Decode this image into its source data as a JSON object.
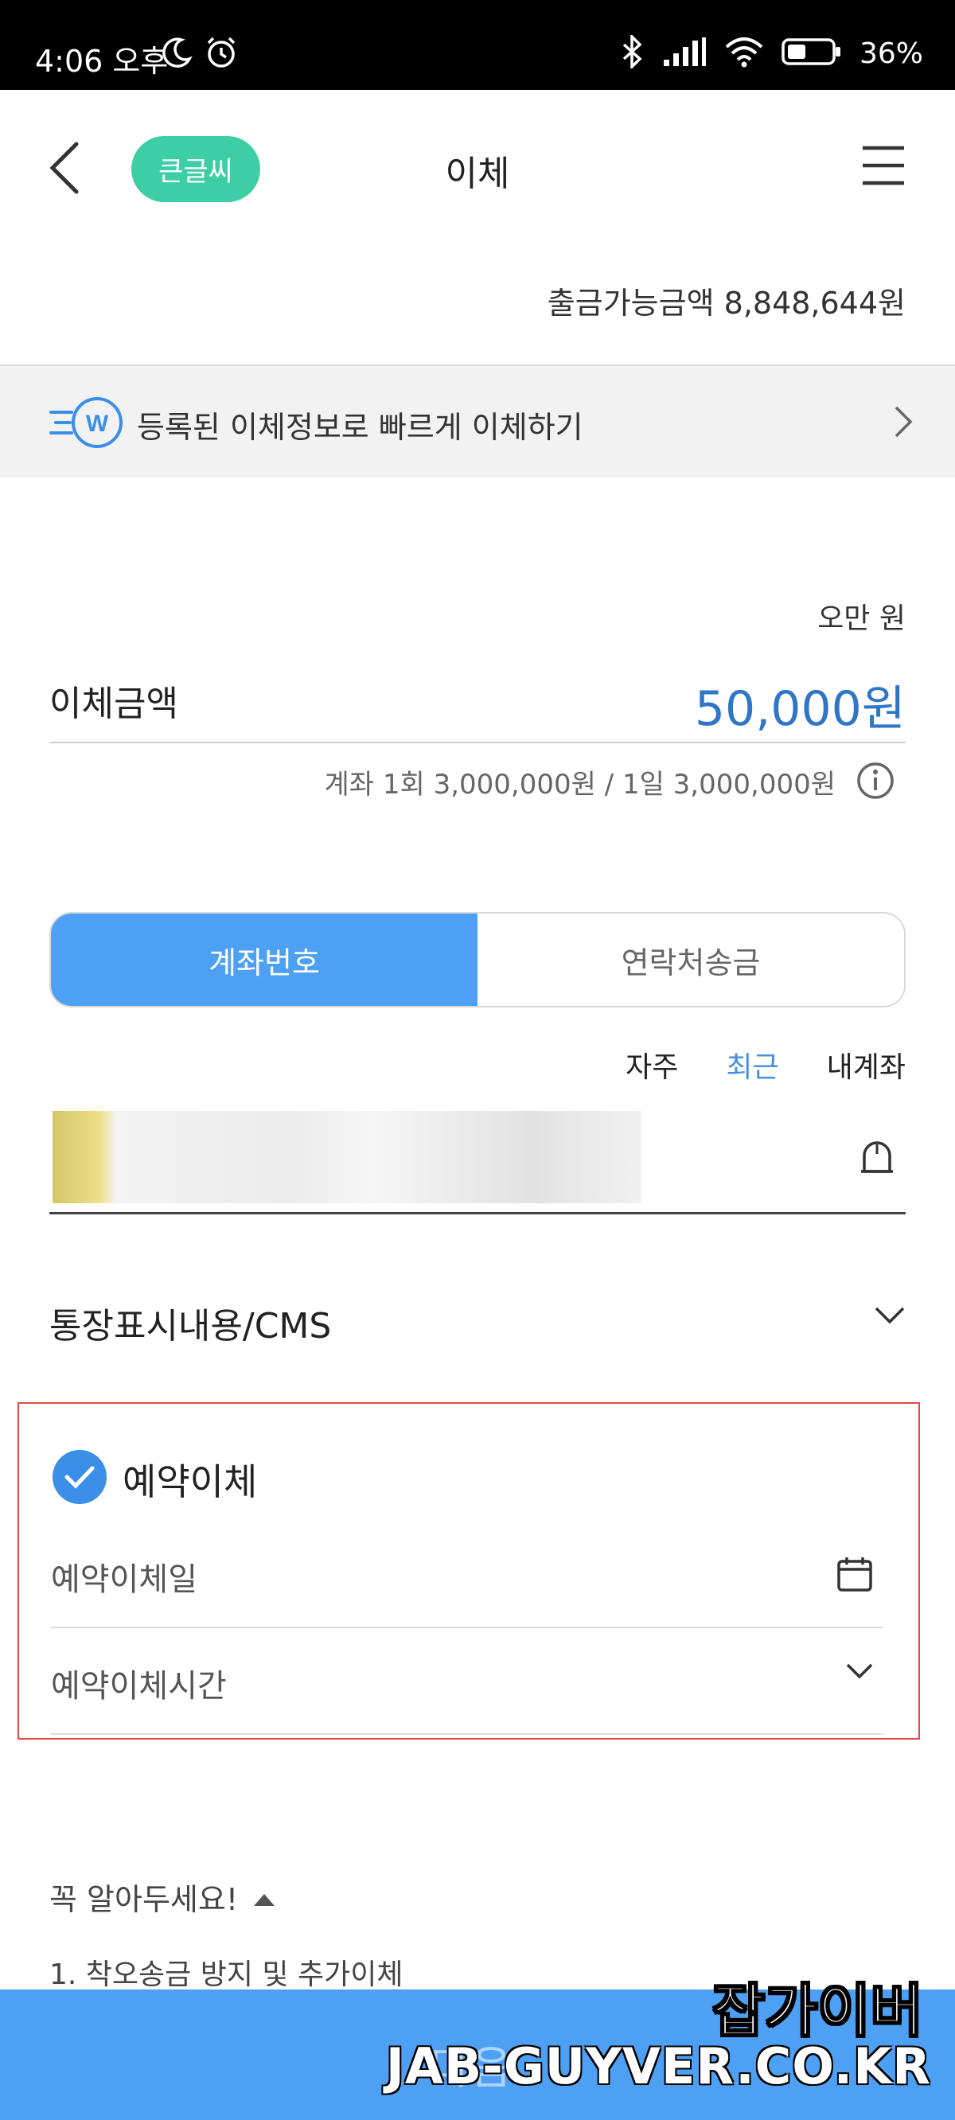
{
  "status_bar": {
    "time": "4:06 오후",
    "battery": "36%"
  },
  "header": {
    "font_size_chip": "큰글씨",
    "title": "이체"
  },
  "balance_text": "출금가능금액 8,848,644원",
  "quick_transfer": {
    "label": "등록된 이체정보로 빠르게 이체하기"
  },
  "amount": {
    "hangul": "오만 원",
    "label": "이체금액",
    "value": "50,000원",
    "limit": "계좌 1회 3,000,000원 / 1일 3,000,000원"
  },
  "tabs": [
    {
      "label": "계좌번호",
      "active": true
    },
    {
      "label": "연락처송금",
      "active": false
    }
  ],
  "account_filters": [
    {
      "label": "자주",
      "selected": false
    },
    {
      "label": "최근",
      "selected": true
    },
    {
      "label": "내계좌",
      "selected": false
    }
  ],
  "memo": {
    "label": "통장표시내용/CMS"
  },
  "reservation": {
    "checked": true,
    "title": "예약이체",
    "date_label": "예약이체일",
    "time_label": "예약이체시간"
  },
  "notice": {
    "title": "꼭 알아두세요!",
    "item_1": "1. 착오송금 방지 및 추가이체"
  },
  "next_button": {
    "label": "다음"
  },
  "watermark": {
    "ko": "잡가이버",
    "en": "JAB-GUYVER.CO.KR"
  },
  "colors": {
    "accent_blue": "#4ea0f4",
    "amount_blue": "#2f76c7",
    "chip_green": "#3dcea6",
    "highlight_red": "#e04a4a"
  }
}
